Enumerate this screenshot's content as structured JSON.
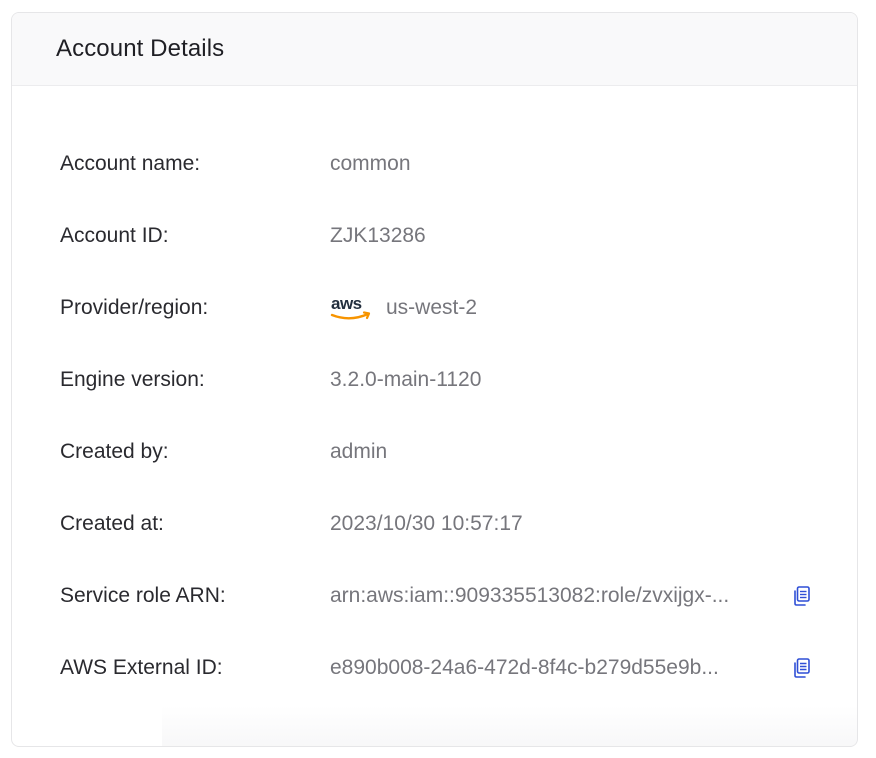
{
  "card": {
    "title": "Account Details"
  },
  "details": [
    {
      "label": "Account name:",
      "value": "common"
    },
    {
      "label": "Account ID:",
      "value": "ZJK13286"
    },
    {
      "label": "Provider/region:",
      "value": "us-west-2",
      "icon": "aws-logo-icon"
    },
    {
      "label": "Engine version:",
      "value": "3.2.0-main-1120"
    },
    {
      "label": "Created by:",
      "value": "admin"
    },
    {
      "label": "Created at:",
      "value": "2023/10/30 10:57:17"
    },
    {
      "label": "Service role ARN:",
      "value": "arn:aws:iam::909335513082:role/zvxijgx-...",
      "icon": "copy-icon"
    },
    {
      "label": "AWS External ID:",
      "value": "e890b008-24a6-472d-8f4c-b279d55e9b...",
      "icon": "copy-icon"
    }
  ],
  "colors": {
    "label": "#2a2a2f",
    "value": "#76767c",
    "copy_icon": "#2f4fd6",
    "aws_orange": "#f79400",
    "aws_text": "#232f3e"
  }
}
